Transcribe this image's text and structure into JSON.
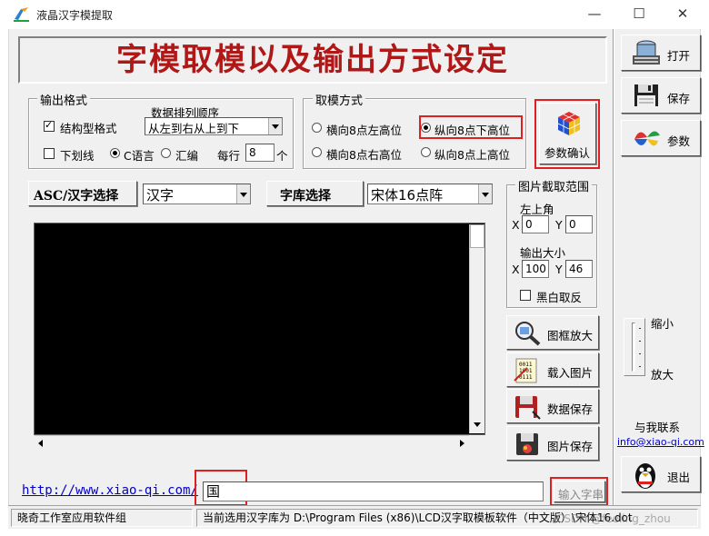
{
  "window": {
    "title": "液晶汉字模提取",
    "minimize": "—",
    "maximize": "☐",
    "close": "✕"
  },
  "heading": "字模取模以及输出方式设定",
  "output_format": {
    "title": "输出格式",
    "structured_label": "结构型格式",
    "structured_checked": true,
    "underline_label": "下划线",
    "underline_checked": false,
    "c_lang_label": "C语言",
    "asm_label": "汇编",
    "per_line_label": "每行",
    "per_line_value": "8",
    "per_line_unit": "个",
    "order_title": "数据排列顺序",
    "order_value": "从左到右从上到下"
  },
  "mode": {
    "title": "取模方式",
    "opt1": "横向8点左高位",
    "opt2": "纵向8点下高位",
    "opt3": "横向8点右高位",
    "opt4": "纵向8点上高位",
    "selected": 2
  },
  "confirm_button": "参数确认",
  "selectors": {
    "asc_label": "ASC/汉字选择",
    "asc_value": "汉字",
    "font_label": "字库选择",
    "font_value": "宋体16点阵"
  },
  "capture": {
    "title": "图片截取范围",
    "top_left_label": "左上角",
    "x_label": "X",
    "y_label": "Y",
    "x_value": "0",
    "y_value": "0",
    "size_label": "输出大小",
    "w_value": "100",
    "h_value": "46",
    "bw_label": "黑白取反",
    "bw_checked": false
  },
  "image_buttons": {
    "zoom": "图框放大",
    "load": "载入图片",
    "save_data": "数据保存",
    "save_image": "图片保存"
  },
  "right_panel": {
    "open": "打开",
    "save": "保存",
    "params": "参数",
    "shrink": "缩小",
    "enlarge": "放大",
    "contact": "与我联系",
    "email": "info@xiao-qi.com",
    "exit": "退出"
  },
  "bottom": {
    "link": "http://www.xiao-qi.com/",
    "input_value": "国",
    "input_button": "输入字串",
    "status_left": "晓奇工作室应用软件组",
    "status_right": "当前选用汉字库为 D:\\Program Files (x86)\\LCD汉字取模板软件（中文版）\\宋体16.dot",
    "watermark": "CSDN @feeling_zhou"
  },
  "colors": {
    "heading_red": "#b01818",
    "highlight_red": "#e02020",
    "link_blue": "#0000cc"
  }
}
